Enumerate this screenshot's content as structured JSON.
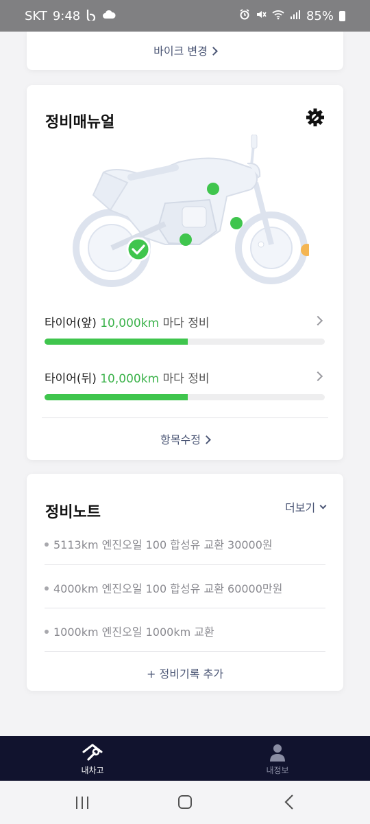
{
  "status_bar": {
    "carrier": "SKT",
    "time": "9:48",
    "battery": "85%",
    "icons": [
      "b-app-icon",
      "cloud-icon",
      "alarm-icon",
      "mute-icon",
      "wifi-icon",
      "signal-icon",
      "battery-icon"
    ]
  },
  "bike_card": {
    "change_bike_label": "바이크 변경"
  },
  "manual_card": {
    "title": "정비매뉴얼",
    "settings_icon": "gear-wrench-icon",
    "items": [
      {
        "name": "타이어(앞)",
        "interval": "10,000km",
        "suffix": "마다 정비",
        "progress": 0.51
      },
      {
        "name": "타이어(뒤)",
        "interval": "10,000km",
        "suffix": "마다 정비",
        "progress": 0.51
      }
    ],
    "edit_label": "항목수정"
  },
  "notes_card": {
    "title": "정비노트",
    "more_label": "더보기",
    "notes": [
      "5113km 엔진오일 100 합성유 교환 30000원",
      "4000km 엔진오일 100 합성유 교환 60000만원",
      "1000km 엔진오일 1000km 교환"
    ],
    "add_label": "+ 정비기록 추가"
  },
  "bottom_nav": {
    "items": [
      {
        "label": "내차고",
        "icon": "garage-wrench-icon",
        "active": true
      },
      {
        "label": "내정보",
        "icon": "person-icon",
        "active": false
      }
    ]
  },
  "colors": {
    "accent_green": "#3fc54d",
    "link_color": "#4b5675",
    "nav_bg": "#11132e",
    "warning_orange": "#f4b552"
  }
}
